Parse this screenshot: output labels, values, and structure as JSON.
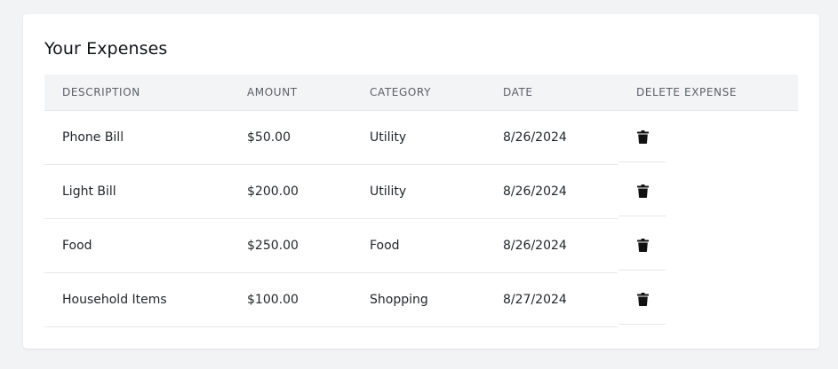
{
  "title": "Your Expenses",
  "headers": {
    "description": "DESCRIPTION",
    "amount": "AMOUNT",
    "category": "CATEGORY",
    "date": "DATE",
    "delete": "DELETE EXPENSE"
  },
  "expenses": [
    {
      "description": "Phone Bill",
      "amount": "$50.00",
      "category": "Utility",
      "date": "8/26/2024",
      "delete_icon": "trash-icon"
    },
    {
      "description": "Light Bill",
      "amount": "$200.00",
      "category": "Utility",
      "date": "8/26/2024",
      "delete_icon": "trash-icon"
    },
    {
      "description": "Food",
      "amount": "$250.00",
      "category": "Food",
      "date": "8/26/2024",
      "delete_icon": "trash-icon"
    },
    {
      "description": "Household Items",
      "amount": "$100.00",
      "category": "Shopping",
      "date": "8/27/2024",
      "delete_icon": "trash-icon"
    }
  ]
}
